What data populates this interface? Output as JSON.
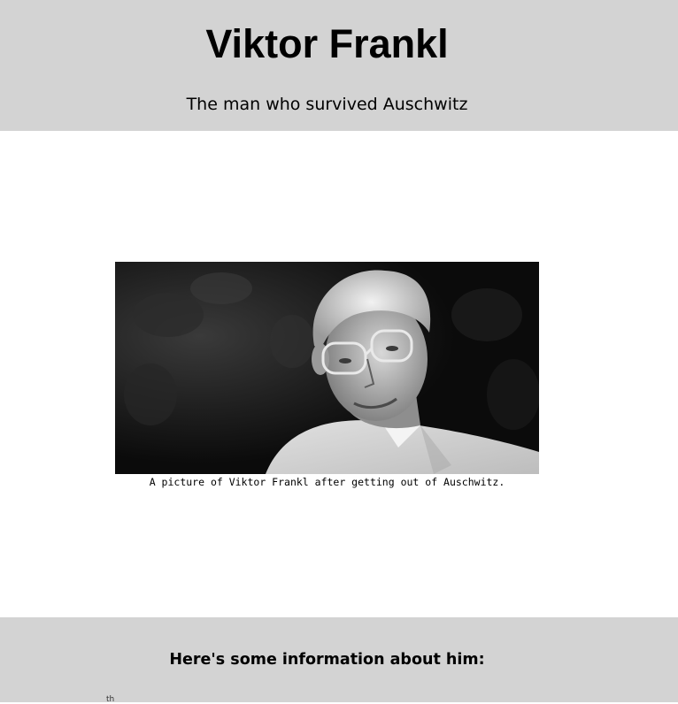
{
  "header": {
    "title": "Viktor Frankl",
    "subtitle": "The man who survived Auschwitz"
  },
  "figure": {
    "image_icon": "portrait-photo",
    "caption": "A picture of Viktor Frankl after getting out of Auschwitz."
  },
  "info": {
    "heading": "Here's some information about him:",
    "partial_text": "th"
  },
  "colors": {
    "section_background": "#d3d3d3",
    "page_background": "#ffffff"
  }
}
